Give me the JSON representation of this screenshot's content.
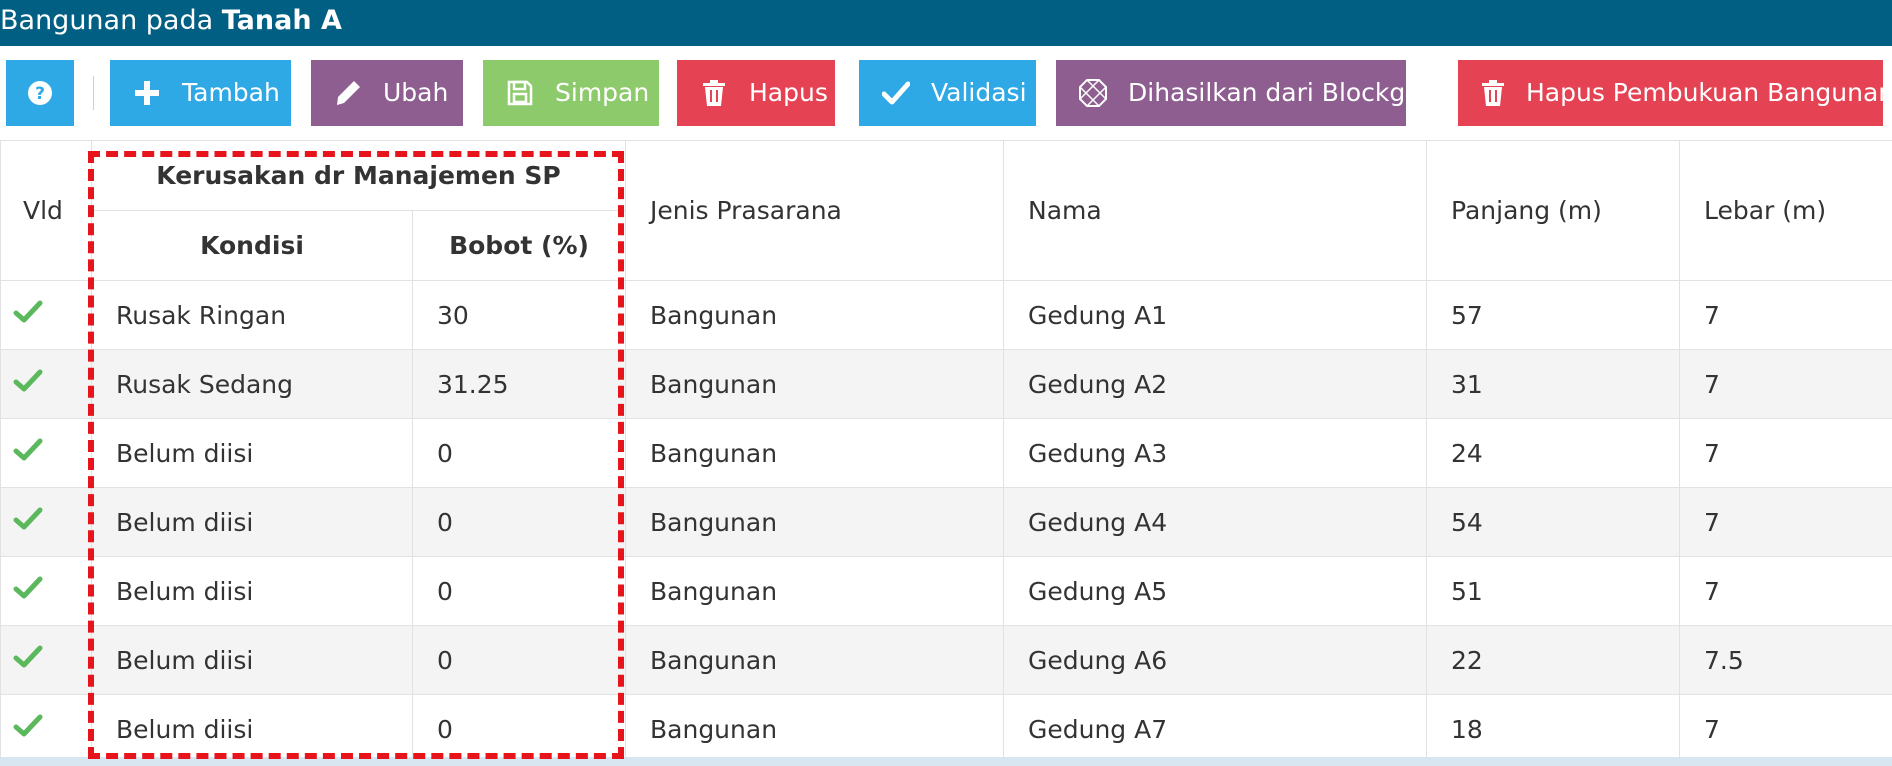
{
  "window": {
    "title_prefix": "Bangunan pada ",
    "title_bold": "Tanah A"
  },
  "toolbar": {
    "help_icon": "question-circle-icon",
    "buttons": [
      {
        "label": "Tambah",
        "icon": "plus-icon",
        "color": "#2fa8e6"
      },
      {
        "label": "Ubah",
        "icon": "pencil-icon",
        "color": "#8d5e8f"
      },
      {
        "label": "Simpan",
        "icon": "floppy-disk-icon",
        "color": "#8dca6c"
      },
      {
        "label": "Hapus",
        "icon": "trash-icon",
        "color": "#e54354"
      },
      {
        "label": "Validasi",
        "icon": "check-icon",
        "color": "#2fa8e6"
      },
      {
        "label": "Dihasilkan dari Blockgrant",
        "icon": "polygon-icon",
        "color": "#8d5e8f"
      },
      {
        "label": "Hapus Pembukuan Bangunan",
        "icon": "trash-icon",
        "color": "#e54354"
      }
    ]
  },
  "table": {
    "headers": {
      "vld": "Vld",
      "group": "Kerusakan dr Manajemen SP",
      "kondisi": "Kondisi",
      "bobot": "Bobot (%)",
      "jenis": "Jenis Prasarana",
      "nama": "Nama",
      "panjang": "Panjang (m)",
      "lebar": "Lebar (m)"
    },
    "rows": [
      {
        "kondisi": "Rusak Ringan",
        "bobot": "30",
        "jenis": "Bangunan",
        "nama": "Gedung A1",
        "panjang": "57",
        "lebar": "7"
      },
      {
        "kondisi": "Rusak Sedang",
        "bobot": "31.25",
        "jenis": "Bangunan",
        "nama": "Gedung A2",
        "panjang": "31",
        "lebar": "7"
      },
      {
        "kondisi": "Belum diisi",
        "bobot": "0",
        "jenis": "Bangunan",
        "nama": "Gedung A3",
        "panjang": "24",
        "lebar": "7"
      },
      {
        "kondisi": "Belum diisi",
        "bobot": "0",
        "jenis": "Bangunan",
        "nama": "Gedung A4",
        "panjang": "54",
        "lebar": "7"
      },
      {
        "kondisi": "Belum diisi",
        "bobot": "0",
        "jenis": "Bangunan",
        "nama": "Gedung A5",
        "panjang": "51",
        "lebar": "7"
      },
      {
        "kondisi": "Belum diisi",
        "bobot": "0",
        "jenis": "Bangunan",
        "nama": "Gedung A6",
        "panjang": "22",
        "lebar": "7.5"
      },
      {
        "kondisi": "Belum diisi",
        "bobot": "0",
        "jenis": "Bangunan",
        "nama": "Gedung A7",
        "panjang": "18",
        "lebar": "7"
      }
    ]
  },
  "colors": {
    "titlebar": "#005f83",
    "highlight_dash": "#e8141c",
    "check_green": "#5cb85c"
  }
}
